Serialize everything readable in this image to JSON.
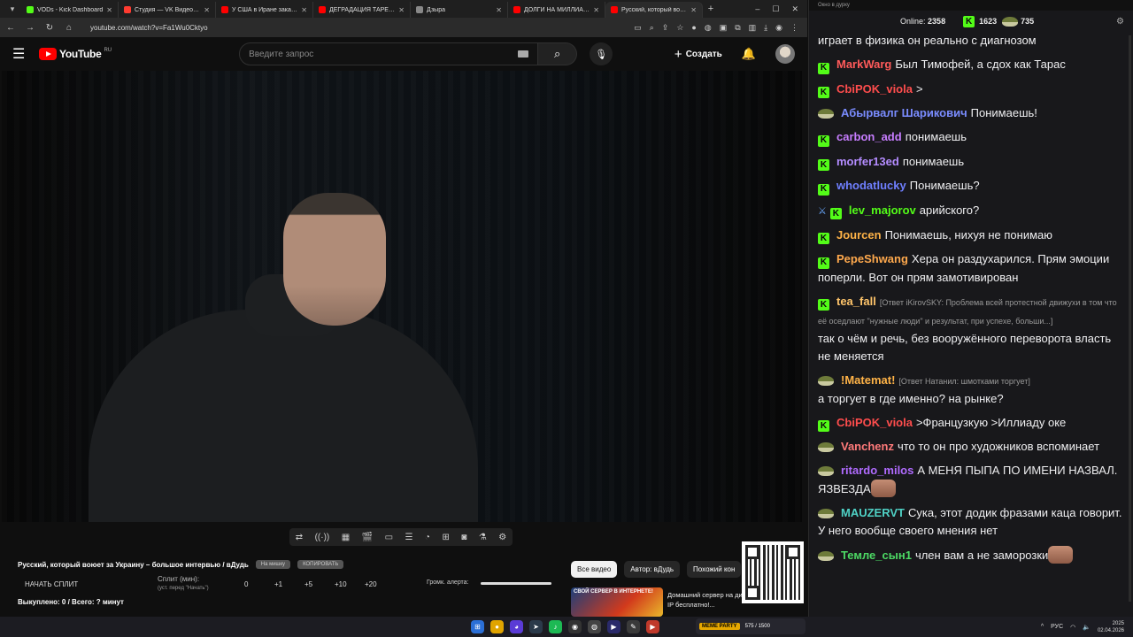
{
  "browser": {
    "tabs": [
      {
        "title": "VODs - Kick Dashboard",
        "color": "#53fc18",
        "active": false
      },
      {
        "title": "Студия — VK Видео Live",
        "color": "#ff3b30",
        "active": false
      },
      {
        "title": "У США в Иране заканчива...",
        "color": "#ff0000",
        "active": false
      },
      {
        "title": "ДЕГРАДАЦИЯ ТАРЕЛОЧНИ...",
        "color": "#ff0000",
        "active": false
      },
      {
        "title": "Дзыра",
        "color": "#888888",
        "active": false
      },
      {
        "title": "ДОЛГИ НА МИЛЛИАРДЫ В...",
        "color": "#ff0000",
        "active": false
      },
      {
        "title": "Русский, который воюет...",
        "color": "#ff0000",
        "active": true
      }
    ],
    "new_tab": "+",
    "url": "youtube.com/watch?v=Fa1Wu0Cktyo"
  },
  "youtube": {
    "logo_text": "YouTube",
    "region": "RU",
    "search_placeholder": "Введите запрос",
    "create_label": "Создать",
    "video_title": "Русский, который воюет за Украину – большое интервью / вДудь",
    "pill_na_mashinku": "На мишку",
    "pill_copy": "КОПИРОВАТЬ",
    "filters": [
      {
        "label": "Все видео",
        "active": true
      },
      {
        "label": "Автор: вДудь",
        "active": false
      },
      {
        "label": "Похожий кон",
        "active": false
      }
    ],
    "rec_thumb_text": "СВОЙ СЕРВЕР В ИНТЕРНЕТЕ!",
    "rec_title": "Домашний сервер на динамическом IP бесплатно!..."
  },
  "split_panel": {
    "start_label": "НАЧАТЬ СПЛИТ",
    "split_label": "Сплит (мин):",
    "split_hint": "(уст. перед \"Начать\")",
    "values": [
      "0",
      "+1",
      "+5",
      "+10",
      "+20"
    ],
    "alert_label": "Громк. алерта:",
    "bought": "Выкуплено: 0 / Всего: ? минут"
  },
  "chat": {
    "window_title": "Окно в дурку",
    "online_label": "Online:",
    "online_count": "2358",
    "kick_count": "1623",
    "pepe_count": "735",
    "messages": [
      {
        "badge": "none",
        "user": "",
        "color": "#ffffff",
        "reply": "",
        "text": "играет в физика он реально с диагнозом"
      },
      {
        "badge": "kick",
        "user": "MarkWarg",
        "color": "#ff5a5a",
        "reply": "",
        "text": "Был Тимофей, а сдох как Тарас"
      },
      {
        "badge": "kick",
        "user": "CbiPOK_viola",
        "color": "#ff4d4d",
        "reply": "",
        "text": ">"
      },
      {
        "badge": "pepe",
        "user": "Абырвалг Шарикович",
        "color": "#7a8cff",
        "reply": "",
        "text": "Понимаешь!"
      },
      {
        "badge": "kick",
        "user": "carbon_add",
        "color": "#c77dff",
        "reply": "",
        "text": "понимаешь"
      },
      {
        "badge": "kick",
        "user": "morfer13ed",
        "color": "#b48cff",
        "reply": "",
        "text": "понимаешь"
      },
      {
        "badge": "kick",
        "user": "whodatlucky",
        "color": "#6f7fff",
        "reply": "",
        "text": "Понимаешь?"
      },
      {
        "badge": "kick2",
        "user": "lev_majorov",
        "color": "#53fc18",
        "reply": "",
        "text": "арийского?"
      },
      {
        "badge": "kick",
        "user": "Jourcen",
        "color": "#ffb347",
        "reply": "",
        "text": "Понимаешь, нихуя не понимаю"
      },
      {
        "badge": "kick",
        "user": "PepeShwang",
        "color": "#ffa94d",
        "reply": "",
        "text": "Хера он раздухарился. Прям эмоции поперли. Вот он прям замотивирован"
      },
      {
        "badge": "kick",
        "user": "tea_fall",
        "color": "#ffc56b",
        "reply": "[Ответ iKirovSKY: Проблема всей протестной движухи в том что её оседлают \"нужные люди\" и результат, при успехе, больши...]",
        "text": "так о чём и речь, без вооружённого переворота власть не меняется"
      },
      {
        "badge": "pepe",
        "user": "!Matemat!",
        "color": "#ffb347",
        "reply": "[Ответ Натанил: шмотками торгует]",
        "text": "а торгует в где именно? на рынке?"
      },
      {
        "badge": "kick",
        "user": "CbiPOK_viola",
        "color": "#ff4d4d",
        "reply": "",
        "text": ">Французкую >Иллиаду оке"
      },
      {
        "badge": "pepe",
        "user": "Vanchenz",
        "color": "#ff7a7a",
        "reply": "",
        "text": "что то он про художников вспоминает"
      },
      {
        "badge": "pepe",
        "user": "ritardo_milos",
        "color": "#b06bff",
        "reply": "",
        "text": "А МЕНЯ ПЫПА ПО ИМЕНИ НАЗВАЛ. ЯЗВЕЗДА"
      },
      {
        "badge": "pepe",
        "user": "MAUZERVT",
        "color": "#4fd1c5",
        "reply": "",
        "text": "Сука, этот додик фразами каца говорит. У него вообще своего мнения нет"
      },
      {
        "badge": "pepe",
        "user": "Темле_сын1",
        "color": "#4cd964",
        "reply": "",
        "text": "член вам а не заморозки"
      }
    ]
  },
  "taskbar": {
    "game_tag": "MEME PARTY",
    "game_counter": "575 / 1500",
    "lang": "РУС",
    "time": "2025",
    "date": "02.04.2026"
  }
}
